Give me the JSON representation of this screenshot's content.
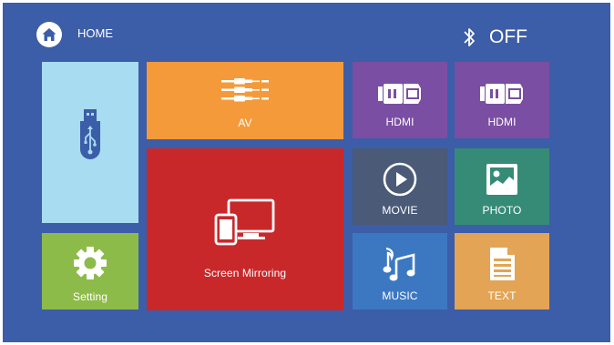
{
  "header": {
    "home_label": "HOME",
    "home_icon": "home-icon",
    "bluetooth_icon": "bluetooth-icon",
    "bluetooth_status": "OFF"
  },
  "tiles": {
    "usb": {
      "label": "",
      "icon": "usb-drive-icon",
      "color": "#a8dcf0"
    },
    "setting": {
      "label": "Setting",
      "icon": "gear-icon",
      "color": "#8dbb4a"
    },
    "av": {
      "label": "AV",
      "icon": "av-cables-icon",
      "color": "#f59a3b"
    },
    "screen_mirroring": {
      "label": "Screen Mirroring",
      "icon": "screen-mirroring-icon",
      "color": "#c9282b"
    },
    "hdmi1": {
      "label": "HDMI",
      "icon": "hdmi-plug-icon",
      "color": "#7a4ea2"
    },
    "hdmi2": {
      "label": "HDMI",
      "icon": "hdmi-plug-icon",
      "color": "#7a4ea2"
    },
    "movie": {
      "label": "MOVIE",
      "icon": "play-icon",
      "color": "#4a5a77"
    },
    "photo": {
      "label": "PHOTO",
      "icon": "photo-icon",
      "color": "#368b77"
    },
    "music": {
      "label": "MUSIC",
      "icon": "music-note-icon",
      "color": "#3c78c2"
    },
    "text": {
      "label": "TEXT",
      "icon": "document-icon",
      "color": "#e3a455"
    }
  },
  "colors": {
    "background": "#3c5da8"
  }
}
